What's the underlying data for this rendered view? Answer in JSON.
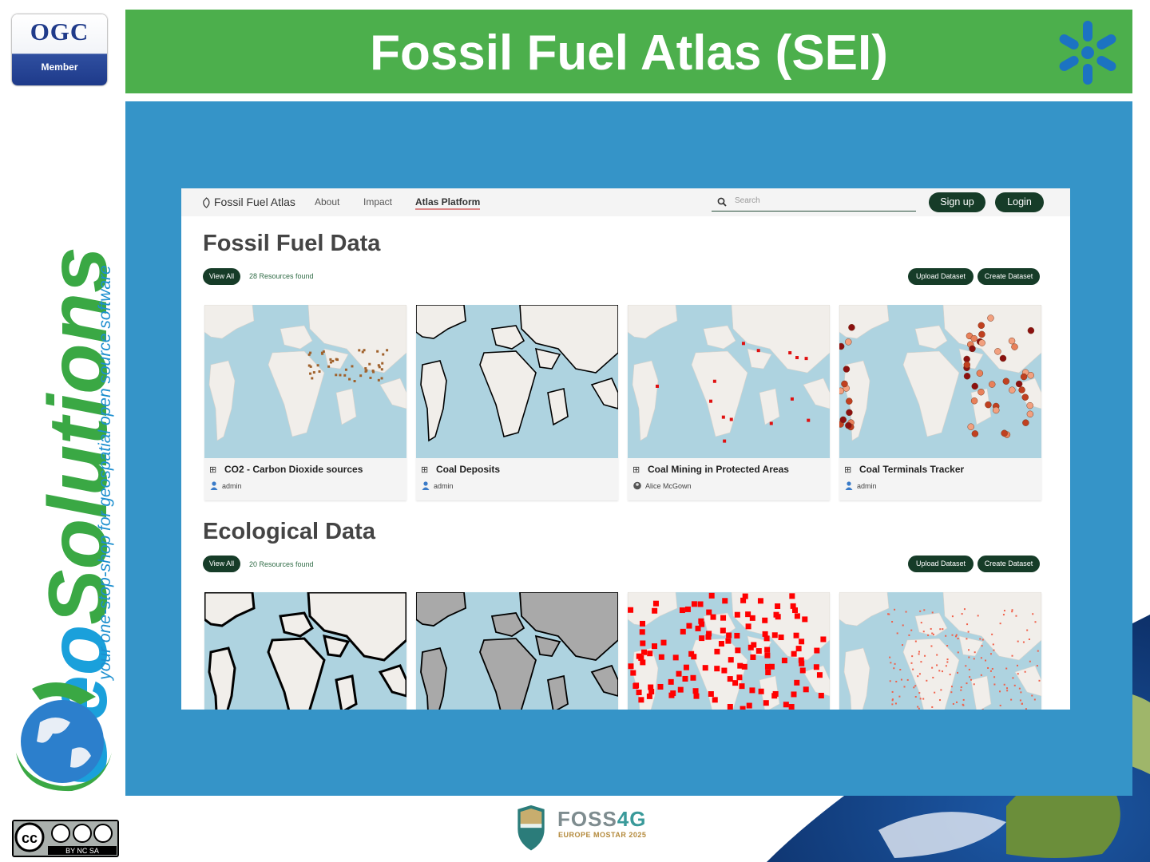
{
  "slide": {
    "title": "Fossil Fuel Atlas (SEI)",
    "ogc": {
      "main": "OGC",
      "sub": "Member"
    },
    "brand": {
      "geo": "Geo",
      "solutions": "Solutions",
      "tagline": "your one-stop-shop for geospatial open source software"
    },
    "footer": {
      "event_name_a": "FOSS",
      "event_name_b": "4G",
      "event_sub": "EUROPE MOSTAR 2025",
      "license": "BY NC SA"
    },
    "colors": {
      "title_bar": "#4caf4c",
      "panel": "#3594c8",
      "button": "#163c28"
    }
  },
  "app": {
    "brand": "Fossil Fuel Atlas",
    "nav": [
      {
        "label": "About"
      },
      {
        "label": "Impact"
      },
      {
        "label": "Atlas Platform",
        "active": true
      }
    ],
    "search": {
      "placeholder": "Search"
    },
    "signup": "Sign up",
    "login": "Login"
  },
  "sections": [
    {
      "title": "Fossil Fuel Data",
      "view_all": "View All",
      "found": "28 Resources found",
      "upload": "Upload Dataset",
      "create": "Create Dataset",
      "cards": [
        {
          "title": "CO2 - Carbon Dioxide sources",
          "author": "admin",
          "map": "brown-dots"
        },
        {
          "title": "Coal Deposits",
          "author": "admin",
          "map": "black-outlines"
        },
        {
          "title": "Coal Mining in Protected Areas",
          "author": "Alice McGown",
          "map": "red-squares"
        },
        {
          "title": "Coal Terminals Tracker",
          "author": "admin",
          "map": "orange-circles"
        }
      ]
    },
    {
      "title": "Ecological Data",
      "view_all": "View All",
      "found": "20 Resources found",
      "upload": "Upload Dataset",
      "create": "Create Dataset",
      "cards": [
        {
          "map": "black-coasts"
        },
        {
          "map": "grey-regions"
        },
        {
          "map": "red-grid"
        },
        {
          "map": "coral-reefs"
        }
      ]
    }
  ]
}
